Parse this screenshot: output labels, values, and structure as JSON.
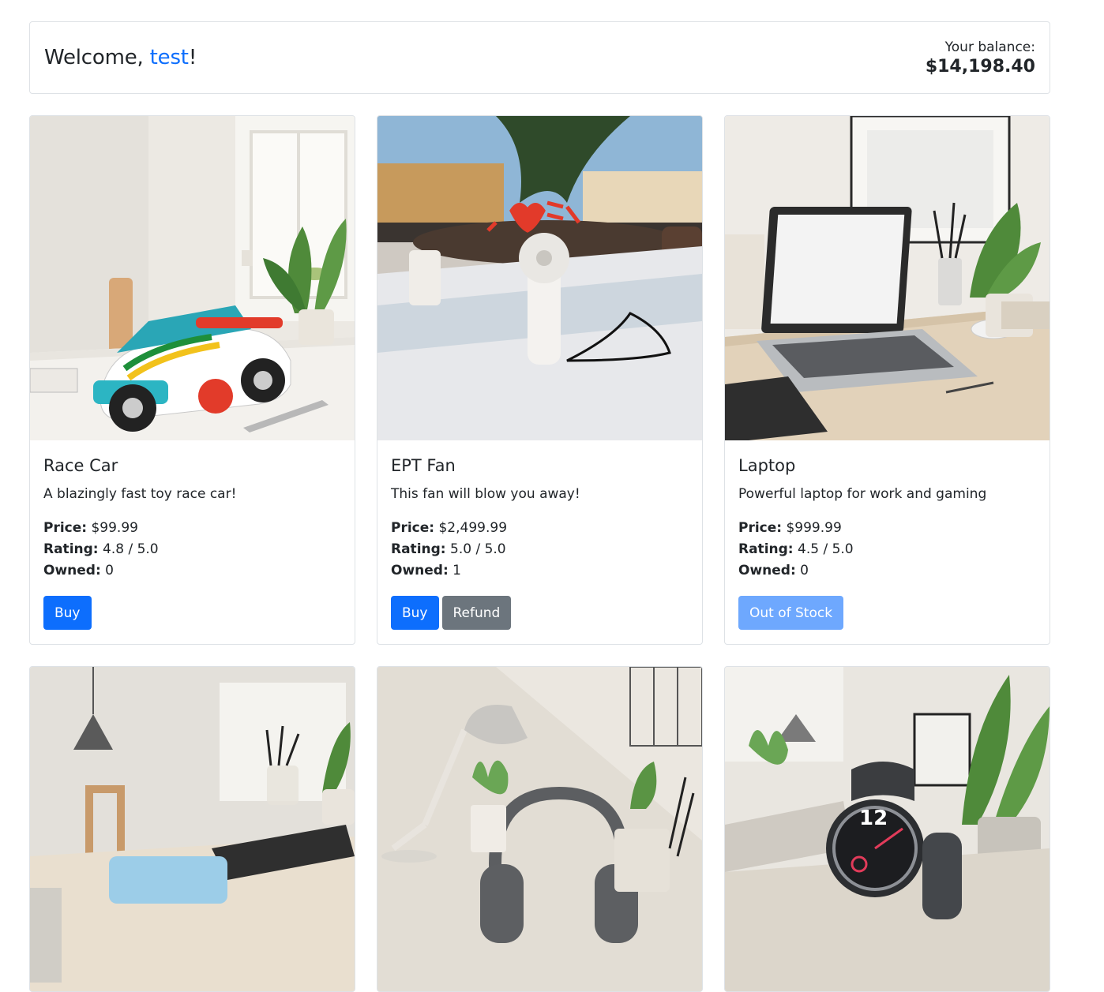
{
  "header": {
    "welcome_prefix": "Welcome, ",
    "username": "test",
    "welcome_suffix": "!",
    "balance_label": "Your balance:",
    "balance_amount": "$14,198.40"
  },
  "labels": {
    "price": "Price:",
    "rating": "Rating:",
    "owned": "Owned:",
    "buy": "Buy",
    "refund": "Refund",
    "out_of_stock": "Out of Stock"
  },
  "products": [
    {
      "name": "Race Car",
      "description": "A blazingly fast toy race car!",
      "price": "$99.99",
      "rating": "4.8 / 5.0",
      "owned": "0",
      "image": "race-car-photo"
    },
    {
      "name": "EPT Fan",
      "description": "This fan will blow you away!",
      "price": "$2,499.99",
      "rating": "5.0 / 5.0",
      "owned": "1",
      "image": "fan-photo"
    },
    {
      "name": "Laptop",
      "description": "Powerful laptop for work and gaming",
      "price": "$999.99",
      "rating": "4.5 / 5.0",
      "owned": "0",
      "image": "laptop-photo"
    },
    {
      "image": "phone-photo"
    },
    {
      "image": "headphones-photo"
    },
    {
      "image": "smartwatch-photo"
    }
  ],
  "colors": {
    "primary": "#0d6efd",
    "secondary": "#6c757d",
    "disabled": "#6ea8fe",
    "border": "#dee2e6"
  }
}
